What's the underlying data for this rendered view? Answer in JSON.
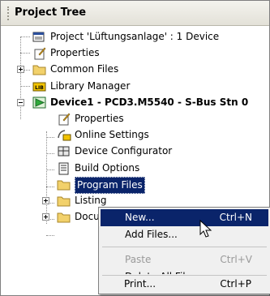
{
  "panel": {
    "title": "Project Tree"
  },
  "tree": {
    "project": "Project 'Lüftungsanlage' : 1 Device",
    "project_properties": "Properties",
    "common_files": "Common Files",
    "library_manager": "Library Manager",
    "library_badge": "LIB",
    "device": "Device1 - PCD3.M5540 - S-Bus Stn 0",
    "device_properties": "Properties",
    "online_settings": "Online Settings",
    "device_configurator": "Device Configurator",
    "build_options": "Build Options",
    "program_files": "Program Files",
    "listing": "Listing",
    "documentation": "Docum"
  },
  "context_menu": {
    "new": "New...",
    "new_shortcut": "Ctrl+N",
    "add_files": "Add Files...",
    "paste": "Paste",
    "paste_shortcut": "Ctrl+V",
    "delete_all": "Delete All Files...",
    "print": "Print...",
    "print_shortcut": "Ctrl+P"
  },
  "colors": {
    "highlight": "#0a246a",
    "folder": "#f2d16b",
    "device_icon": "#2eaa3a"
  }
}
